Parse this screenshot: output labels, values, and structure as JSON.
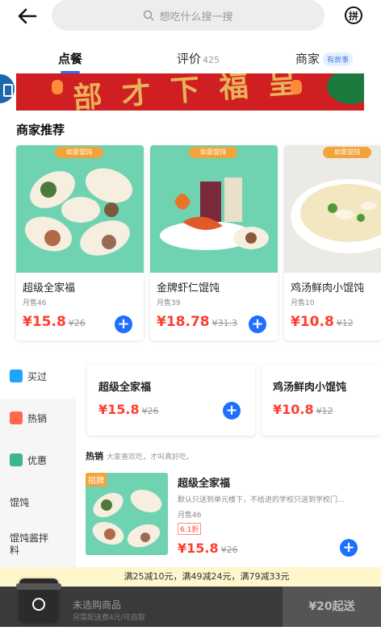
{
  "search": {
    "placeholder": "想吃什么搜一搜"
  },
  "header": {
    "pin_label": "拼"
  },
  "tabs": [
    {
      "label": "点餐"
    },
    {
      "label": "评价",
      "count": "425"
    },
    {
      "label": "商家",
      "badge": "有故事"
    }
  ],
  "recommend": {
    "title": "商家推荐",
    "brand_tag": "如意馄饨",
    "items": [
      {
        "name": "超级全家福",
        "sales": "月售46",
        "price": "¥15.8",
        "orig": "¥26"
      },
      {
        "name": "金牌虾仁馄饨",
        "sales": "月售39",
        "price": "¥18.78",
        "orig": "¥31.3"
      },
      {
        "name": "鸡汤鲜肉小馄饨",
        "sales": "月售10",
        "price": "¥10.8",
        "orig": "¥12"
      }
    ]
  },
  "categories": [
    {
      "label": "买过"
    },
    {
      "label": "热销"
    },
    {
      "label": "优惠"
    },
    {
      "label": "馄饨"
    },
    {
      "label": "馄饨酱拌\n料"
    }
  ],
  "bought": [
    {
      "name": "超级全家福",
      "price": "¥15.8",
      "orig": "¥26"
    },
    {
      "name": "鸡汤鲜肉小馄饨",
      "price": "¥10.8",
      "orig": "¥12"
    }
  ],
  "hot": {
    "title": "热销",
    "subtitle": "大家喜欢吃，才叫真好吃。",
    "sign_tag": "招牌",
    "item": {
      "name": "超级全家福",
      "desc": "默认只送到单元楼下，不给进的学校只送到学校门...",
      "sales": "月售46",
      "discount": "6.1折",
      "price": "¥15.8",
      "orig": "¥26"
    }
  },
  "promo": "满25减10元，满49减24元，满79减33元",
  "cart": {
    "empty": "未选购商品",
    "fee": "另需配送费4元/可自取",
    "min": "¥20起送"
  },
  "colors": {
    "accent": "#1e6fff",
    "price": "#ff3d2e",
    "brand_green": "#6fd3b2"
  }
}
